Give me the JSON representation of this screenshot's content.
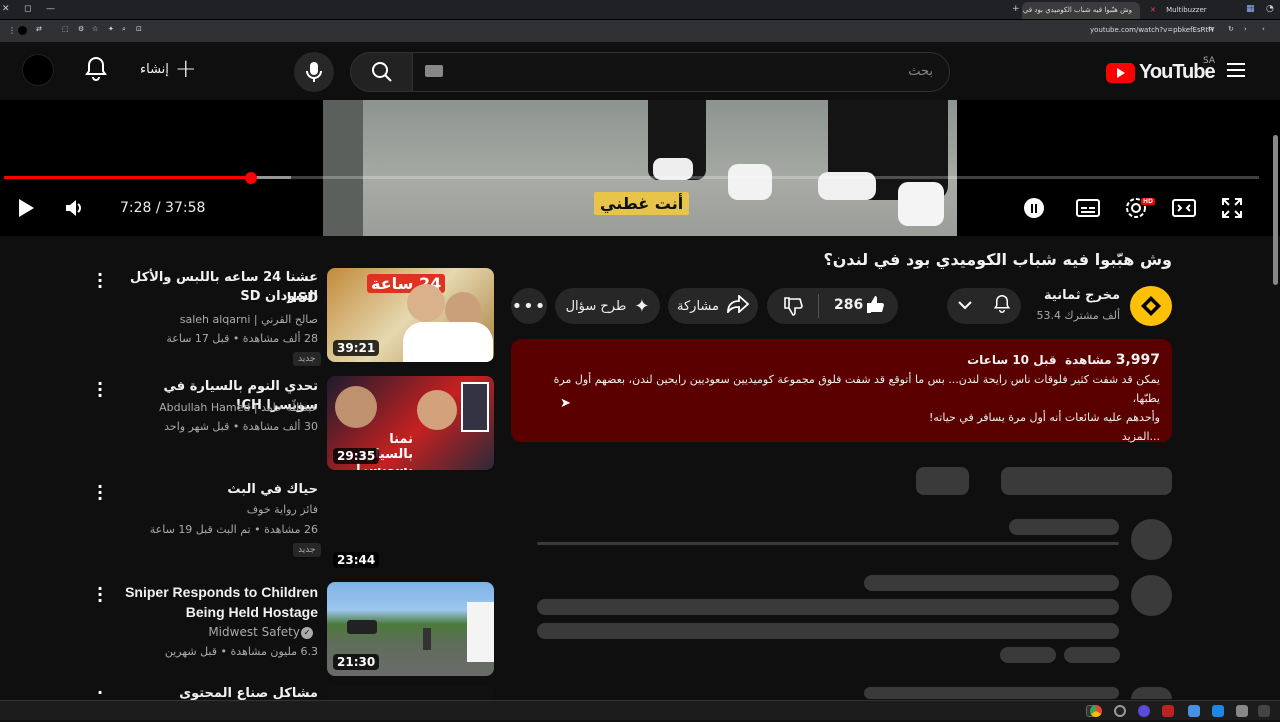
{
  "browser": {
    "tabs": [
      {
        "label": "Multibuzzer"
      },
      {
        "label": "وش هبّبوا فيه شباب الكوميدي بود في لندن؟"
      }
    ],
    "url": "youtube.com/watch?v=pbkefEsRtIY"
  },
  "header": {
    "logo": "YouTube",
    "country": "SA",
    "search_placeholder": "بحث",
    "create_label": "إنشاء"
  },
  "player": {
    "time": "7:28 / 37:58",
    "subtitle": "أنت غطني",
    "progress_fraction": 0.197,
    "hd_badge": "HD"
  },
  "video": {
    "title": "وش هبّبوا فيه شباب الكوميدي بود في لندن؟",
    "channel": "مخرج ثمانية",
    "subscribers": "53.4 ألف مشترك",
    "likes": "286",
    "share_label": "مشاركة",
    "ask_label": "طرح سؤال",
    "views": "3,997",
    "views_suffix": "مشاهدة",
    "time_ago": "قبل 10 ساعات",
    "desc_line1": "يمكن قد شفت كثير فلوقات ناس رايحة لندن... بس ما أتوقع قد شفت فلوق مجموعة كوميديين سعوديين رايحين لندن، بعضهم أول مرة يطبّها،",
    "desc_line2": "وأحدهم عليه شائعات أنه أول مرة يسافر في حياته!",
    "more_label": "...المزيد"
  },
  "recommendations": [
    {
      "title1": "عشنا 24 ساعه باللبس والأكل السودان SD",
      "title2": "SD!!",
      "channel": "صالح القرني | saleh alqarni",
      "meta": "28 ألف مشاهدة • قبل 17 ساعة",
      "badge": "جديد",
      "duration": "39:21",
      "thumb_text": "24 ساعة"
    },
    {
      "title1": "تحدي النوم بالسيارة في سويسرا CH!",
      "title2": "",
      "channel": "عبداللّه حامد | Abdullah Hamed",
      "meta": "30 ألف مشاهدة • قبل شهر واحد",
      "badge": "",
      "duration": "29:35",
      "thumb_text": "نمنا بالسيارة بسويسرا"
    },
    {
      "title1": "حياك في البث",
      "title2": "",
      "channel": "فائز رواية خوف",
      "meta": "26 مشاهدة • تم البث قبل 19 ساعة",
      "badge": "جديد",
      "duration": "23:44",
      "thumb_text": ""
    },
    {
      "title1": "Sniper Responds to Children",
      "title2": "Being Held Hostage",
      "channel": "Midwest Safety",
      "meta": "6.3 مليون مشاهدة • قبل شهرين",
      "badge": "",
      "duration": "21:30",
      "thumb_text": ""
    },
    {
      "title1": "مشاكل صناع المحتوى (المفتعلة) 💥 |",
      "title2": "",
      "channel": "",
      "meta": "",
      "badge": "",
      "duration": "",
      "thumb_text": ""
    }
  ],
  "colors": {
    "accent": "#ff0000",
    "description_bg": "#5a0000",
    "background": "#0f0f0f"
  }
}
